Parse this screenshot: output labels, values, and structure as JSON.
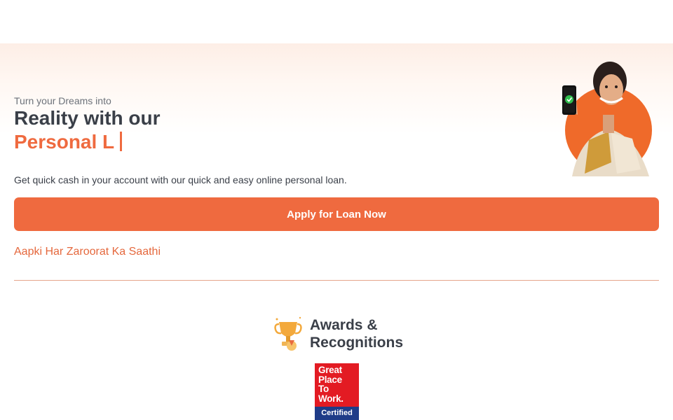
{
  "hero": {
    "tagline": "Turn your Dreams into",
    "title": "Reality with our",
    "typed_text": "Personal L",
    "description": "Get quick cash in your account with our quick and easy online personal loan.",
    "cta_label": "Apply for Loan Now",
    "slogan": "Aapki Har Zaroorat Ka Saathi",
    "image_icon": "woman-with-phone-illustration"
  },
  "awards": {
    "title": "Awards & Recognitions",
    "icon": "trophy-icon",
    "badge": {
      "text": "Great\nPlace\nTo\nWork.",
      "footer": "Certified"
    }
  },
  "colors": {
    "accent": "#ef6a3f",
    "heading": "#3a3f48",
    "badge_red": "#e31b23",
    "badge_blue": "#1f3c88"
  }
}
